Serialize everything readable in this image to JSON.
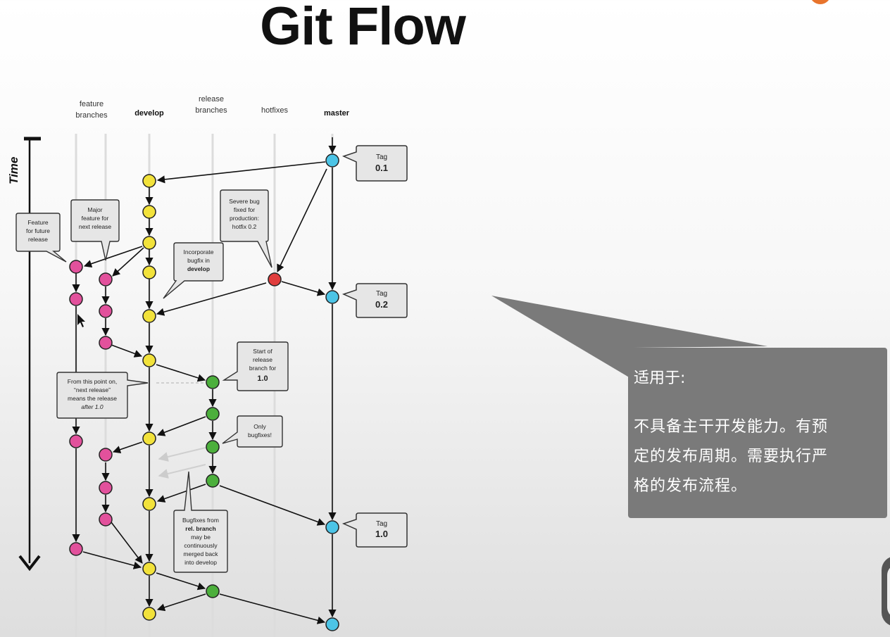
{
  "slide": {
    "title": "Git Flow"
  },
  "diagram": {
    "columns": {
      "feature_1": "feature",
      "feature_2": "branches",
      "develop": "develop",
      "release_1": "release",
      "release_2": "branches",
      "hotfixes": "hotfixes",
      "master": "master"
    },
    "time_label": "Time",
    "tags": [
      {
        "line1": "Tag",
        "line2": "0.1"
      },
      {
        "line1": "Tag",
        "line2": "0.2"
      },
      {
        "line1": "Tag",
        "line2": "1.0"
      }
    ],
    "notes": {
      "feature_future": [
        "Feature",
        "for future",
        "release"
      ],
      "major_feature": [
        "Major",
        "feature for",
        "next release"
      ],
      "severe_bug": [
        "Severe bug",
        "fixed for",
        "production:",
        "hotfix 0.2"
      ],
      "incorporate": [
        "Incorporate",
        "bugfix in",
        "develop"
      ],
      "start_release": [
        "Start of",
        "release",
        "branch for",
        "1.0"
      ],
      "from_this_point": [
        "From this point on,",
        "“next release”",
        "means the release",
        "after 1.0"
      ],
      "only_bugfixes": [
        "Only",
        "bugfixes!"
      ],
      "bugfixes_from": [
        "Bugfixes from",
        "rel. branch",
        "may be",
        "continuously",
        "merged back",
        "into develop"
      ]
    },
    "colors": {
      "feature": "#e2519c",
      "develop": "#f2e23b",
      "release": "#4caf3c",
      "hotfix": "#e03d3d",
      "master": "#4cc4e6"
    }
  },
  "callout": {
    "heading": "适用于:",
    "lines": [
      "不具备主干开发能力。有预",
      "定的发布周期。需要执行严",
      "格的发布流程。"
    ]
  }
}
